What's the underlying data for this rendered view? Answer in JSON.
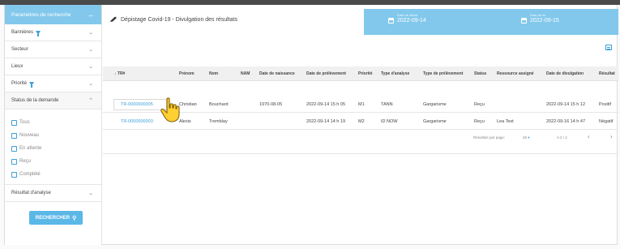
{
  "sidebar": {
    "header_title": "Paramètres de recherche",
    "back_icon": "arrow-left-icon",
    "rows": [
      {
        "label": "Bannières",
        "has_filter": true,
        "chevron": "chevron-down-icon"
      },
      {
        "label": "Secteur",
        "has_filter": false,
        "chevron": "chevron-down-icon"
      },
      {
        "label": "Lieux",
        "has_filter": false,
        "chevron": "chevron-down-icon"
      },
      {
        "label": "Priorité",
        "has_filter": true,
        "chevron": "chevron-down-icon"
      }
    ],
    "status_section": {
      "label": "Status de la demande",
      "chevron": "chevron-up-icon"
    },
    "status_options": [
      "Tous",
      "Nouveau",
      "En attente",
      "Reçu",
      "Complété"
    ],
    "result_section": {
      "label": "Résultat d'analyse",
      "chevron": "chevron-down-icon"
    },
    "search_button": "RECHERCHER"
  },
  "header": {
    "title": "Dépistage Covid-19 - Divulgation des résultats",
    "start_date": {
      "label": "Date de début",
      "value": "2022-09-14"
    },
    "end_date": {
      "label": "Date de fin",
      "value": "2022-09-15"
    }
  },
  "table": {
    "columns": [
      "TR#",
      "Prénom",
      "Nom",
      "NAM",
      "Date de naissance",
      "Date de prélèvement",
      "Priorité",
      "Type d'analyse",
      "Type de prélèvement",
      "Status",
      "Ressource assigné",
      "Date de divulgation",
      "Résultat"
    ],
    "rows": [
      [
        "TR-0000000005",
        "Christian",
        "Bouchard",
        "",
        "1970-08-05",
        "2022-09-14 15 h 05",
        "M1",
        "TANN",
        "Gargarisme",
        "Reçu",
        "",
        "2022-09-14 15 h 12",
        "Positif"
      ],
      [
        "TR-0000000003",
        "Alexis",
        "Tremblay",
        "",
        "",
        "2022-09-14 14 h 19",
        "M2",
        "ID NOW",
        "Gargarisme",
        "Reçu",
        "Lea Test",
        "2022-09-16 14 h 47",
        "Négatif"
      ]
    ]
  },
  "pager": {
    "per_page_label": "Résultats par page:",
    "per_page_value": "25",
    "range": "1-2 / 2",
    "prev": "‹",
    "next": "›"
  },
  "colors": {
    "accent": "#82c8ec",
    "link": "#3da0d8"
  }
}
